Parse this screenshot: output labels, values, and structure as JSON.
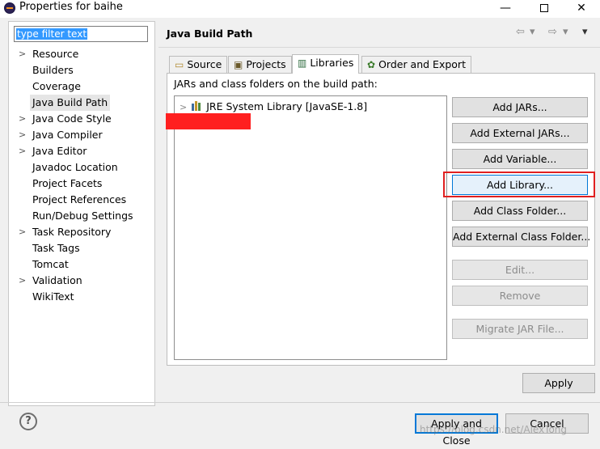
{
  "window": {
    "title": "Properties for baihe",
    "controls": {
      "minimize": "—",
      "close": "✕"
    }
  },
  "filter": {
    "value": "type filter text"
  },
  "tree": [
    {
      "label": "Resource",
      "expandable": true
    },
    {
      "label": "Builders",
      "expandable": false
    },
    {
      "label": "Coverage",
      "expandable": false
    },
    {
      "label": "Java Build Path",
      "expandable": false,
      "selected": true
    },
    {
      "label": "Java Code Style",
      "expandable": true
    },
    {
      "label": "Java Compiler",
      "expandable": true
    },
    {
      "label": "Java Editor",
      "expandable": true
    },
    {
      "label": "Javadoc Location",
      "expandable": false
    },
    {
      "label": "Project Facets",
      "expandable": false
    },
    {
      "label": "Project References",
      "expandable": false
    },
    {
      "label": "Run/Debug Settings",
      "expandable": false
    },
    {
      "label": "Task Repository",
      "expandable": true
    },
    {
      "label": "Task Tags",
      "expandable": false
    },
    {
      "label": "Tomcat",
      "expandable": false
    },
    {
      "label": "Validation",
      "expandable": true
    },
    {
      "label": "WikiText",
      "expandable": false
    }
  ],
  "page": {
    "title": "Java Build Path"
  },
  "nav": {
    "back": "⇦",
    "forward": "⇨",
    "menu": "▾"
  },
  "tabs": [
    {
      "label": "Source",
      "icon": "source-folder-icon"
    },
    {
      "label": "Projects",
      "icon": "projects-icon"
    },
    {
      "label": "Libraries",
      "icon": "libraries-icon",
      "active": true
    },
    {
      "label": "Order and Export",
      "icon": "order-export-icon"
    }
  ],
  "libraries": {
    "caption": "JARs and class folders on the build path:",
    "items": [
      {
        "label": "JRE System Library [JavaSE-1.8]"
      }
    ]
  },
  "buttons": {
    "add_jars": "Add JARs...",
    "add_external_jars": "Add External JARs...",
    "add_variable": "Add Variable...",
    "add_library": "Add Library...",
    "add_class_folder": "Add Class Folder...",
    "add_external_class_folder": "Add External Class Folder...",
    "edit": "Edit...",
    "remove": "Remove",
    "migrate_jar": "Migrate JAR File...",
    "apply": "Apply",
    "apply_and_close": "Apply and Close",
    "cancel": "Cancel",
    "help": "?"
  },
  "watermark": "https://blog.csdn.net/AlexTong",
  "colors": {
    "highlight": "#e02020",
    "selection": "#3399ff",
    "redaction": "#ff1f1f"
  }
}
